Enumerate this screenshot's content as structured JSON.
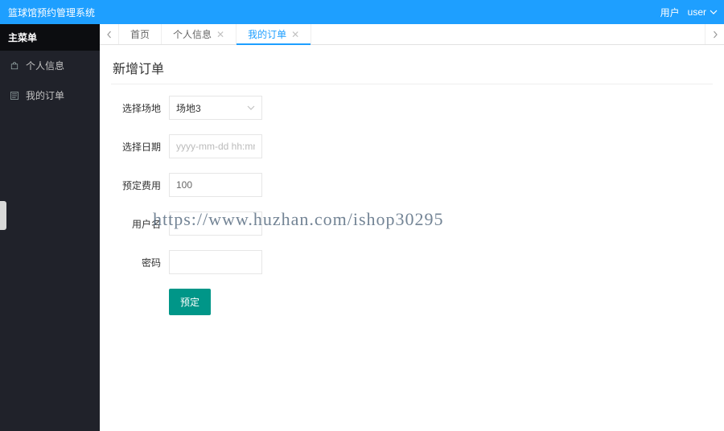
{
  "topbar": {
    "title": "篮球馆预约管理系统",
    "user_label": "用户",
    "user_name": "user"
  },
  "sidebar": {
    "menu_title": "主菜单",
    "items": [
      {
        "label": "个人信息"
      },
      {
        "label": "我的订单"
      }
    ]
  },
  "tabs": {
    "items": [
      {
        "label": "首页",
        "closable": false,
        "active": false
      },
      {
        "label": "个人信息",
        "closable": true,
        "active": false
      },
      {
        "label": "我的订单",
        "closable": true,
        "active": true
      }
    ]
  },
  "page": {
    "title": "新增订单",
    "form": {
      "venue_label": "选择场地",
      "venue_value": "场地3",
      "date_label": "选择日期",
      "date_placeholder": "yyyy-mm-dd hh:mm:ss",
      "date_value": "",
      "cost_label": "预定费用",
      "cost_value": "100",
      "username_label": "用户名",
      "username_value": "",
      "password_label": "密码",
      "password_value": "",
      "submit_label": "预定"
    }
  },
  "watermark": "https://www.huzhan.com/ishop30295"
}
